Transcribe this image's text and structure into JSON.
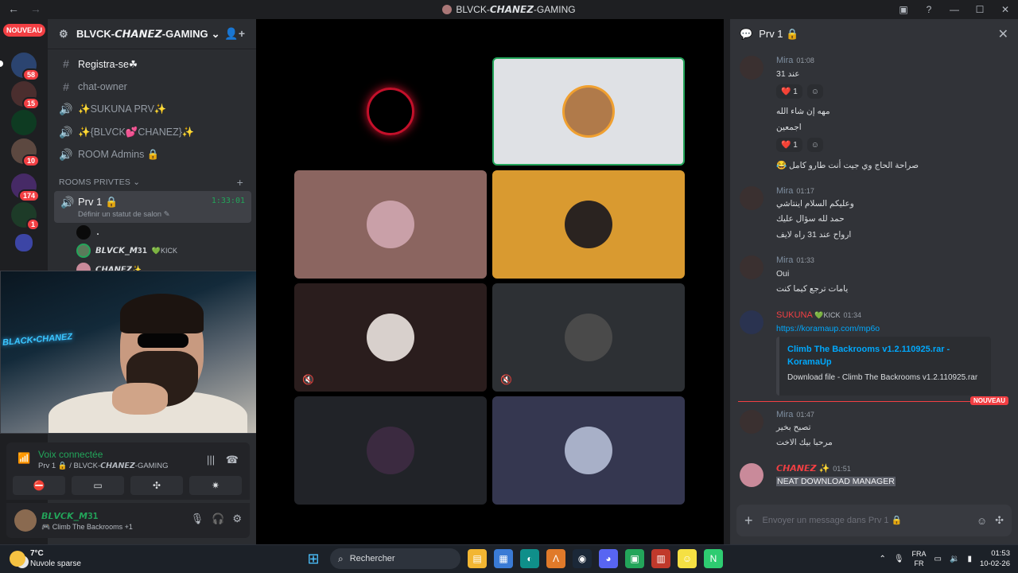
{
  "window": {
    "title": "BLVCK-𝘾𝙃𝘼𝙉𝙀𝙕-GAMING",
    "back": "←",
    "forward": "→",
    "controls": [
      "▣",
      "?",
      "—",
      "☐",
      "✕"
    ]
  },
  "servers": {
    "new_pill": "NOUVEAU",
    "badges": [
      "58",
      "15",
      "10",
      "174",
      "1"
    ],
    "colors": [
      "#2b4470",
      "#4a2e2e",
      "#0e3b22",
      "#5c4840",
      "#462a66",
      "#1d3b28"
    ]
  },
  "guild": {
    "name": "BLVCK-𝘾𝙃𝘼𝙉𝙀𝙕-GAMING",
    "chevron": "⌄",
    "channels": [
      {
        "icon": "#",
        "label": "Registra-se☘"
      },
      {
        "icon": "#",
        "label": "chat-owner"
      },
      {
        "icon": "🔊",
        "label": "✨SUKUNA PRV✨"
      },
      {
        "icon": "🔊",
        "label": "✨{BLVCK💕CHANEZ}✨"
      },
      {
        "icon": "🔊",
        "label": "ROOM Admins 🔒"
      }
    ],
    "category": "ROOMS PRIVTES",
    "active_channel": {
      "name": "Prv 1 🔒",
      "timer": "1:33:01",
      "status": "Définir un statut de salon ✎"
    },
    "voice_users": [
      {
        "name": ".",
        "kick": ""
      },
      {
        "name": "𝘽𝙇𝙑𝘾𝙆_𝙈31",
        "kick": "💚KICK"
      },
      {
        "name": "𝘾𝙃𝘼𝙉𝙀𝙕✨",
        "kick": ""
      }
    ]
  },
  "webcam": {
    "overlay_text": "BLACK•CHANEZ"
  },
  "voice_panel": {
    "title": "Voix connectée",
    "subtitle": "Prv 1 🔒 / BLVCK-𝘾𝙃𝘼𝙉𝙀𝙕-GAMING",
    "buttons": [
      "⛔",
      "▭",
      "✣",
      "✷"
    ]
  },
  "user_panel": {
    "name": "𝘽𝙇𝙑𝘾𝙆_𝙈31",
    "status": "🎮 Climb The Backrooms +1"
  },
  "stage": {
    "tiles": [
      {
        "bg": "#000000",
        "avatar": "#8a0f1a",
        "muted": false
      },
      {
        "bg": "#dfe1e5",
        "avatar": "#b07a4a",
        "muted": false
      },
      {
        "bg": "#8b6560",
        "avatar": "#c9a0a8",
        "muted": false
      },
      {
        "bg": "#d99a30",
        "avatar": "#2a2320",
        "muted": false
      },
      {
        "bg": "#2a1d1d",
        "avatar": "#d8d0cc",
        "muted": true
      },
      {
        "bg": "#2d3034",
        "avatar": "#4a4a4a",
        "muted": true
      },
      {
        "bg": "#212328",
        "avatar": "#3b2a40",
        "muted": false
      },
      {
        "bg": "#353750",
        "avatar": "#a8b0c8",
        "muted": false
      }
    ]
  },
  "chat": {
    "title": "Prv 1 🔒",
    "messages": [
      {
        "author": "Mira",
        "time": "01:08",
        "color": "#7e8ea0"
      },
      {
        "author": "Mira",
        "time": "01:17",
        "color": "#7e8ea0"
      },
      {
        "author": "Mira",
        "time": "01:33",
        "color": "#7e8ea0"
      },
      {
        "author": "SUKUNA",
        "badge": "💚KICK",
        "time": "01:34",
        "color": "#f23f43"
      },
      {
        "author": "Mira",
        "time": "01:47",
        "color": "#7e8ea0"
      },
      {
        "author": "𝘾𝙃𝘼𝙉𝙀𝙕 ✨",
        "time": "01:51",
        "color": "#f23f43"
      }
    ],
    "lines": {
      "m1a": "عند 31",
      "m1b": "مهه إن شاء الله",
      "m1c": "اجمعين",
      "m1d": "😂 صراحة الحاج وي جيت أنت طارو كامل",
      "m2a": "وعليكم السلام اينتاشي",
      "m2b": "حمد لله سؤال عليك",
      "m2c": "ارواح عند 31 راه لايف",
      "m3a": "Oui",
      "m3b": "يامات ترجع كيما كنت",
      "m4a": "https://koramaup.com/mp6o",
      "m5a": "تصبح بخير",
      "m5b": "مرحبا بيك الاخت",
      "m6a": "NEAT DOWNLOAD MANAGER"
    },
    "reactions": {
      "heart": "❤️",
      "count": "1",
      "add": "☺"
    },
    "embed": {
      "title": "Climb The Backrooms v1.2.110925.rar - KoramaUp",
      "desc": "Download file - Climb The Backrooms v1.2.110925.rar"
    },
    "new_divider": "NOUVEAU",
    "composer_placeholder": "Envoyer un message dans Prv 1 🔒"
  },
  "taskbar": {
    "temp": "7°C",
    "weather": "Nuvole sparse",
    "search": "Rechercher",
    "lang_top": "FRA",
    "lang_bottom": "FR",
    "time": "01:53",
    "date": "10-02-26",
    "apps": [
      {
        "bg": "#f2b632",
        "glyph": "▤"
      },
      {
        "bg": "#3a7bd5",
        "glyph": "▦"
      },
      {
        "bg": "#0f8f8a",
        "glyph": "◐"
      },
      {
        "bg": "#e07a2a",
        "glyph": "Λ"
      },
      {
        "bg": "#1b2838",
        "glyph": "◉"
      },
      {
        "bg": "#5865f2",
        "glyph": "◕"
      },
      {
        "bg": "#23a55a",
        "glyph": "▣"
      },
      {
        "bg": "#c0392b",
        "glyph": "▥"
      },
      {
        "bg": "#f5e043",
        "glyph": "☺"
      },
      {
        "bg": "#2ecc71",
        "glyph": "N"
      }
    ]
  }
}
